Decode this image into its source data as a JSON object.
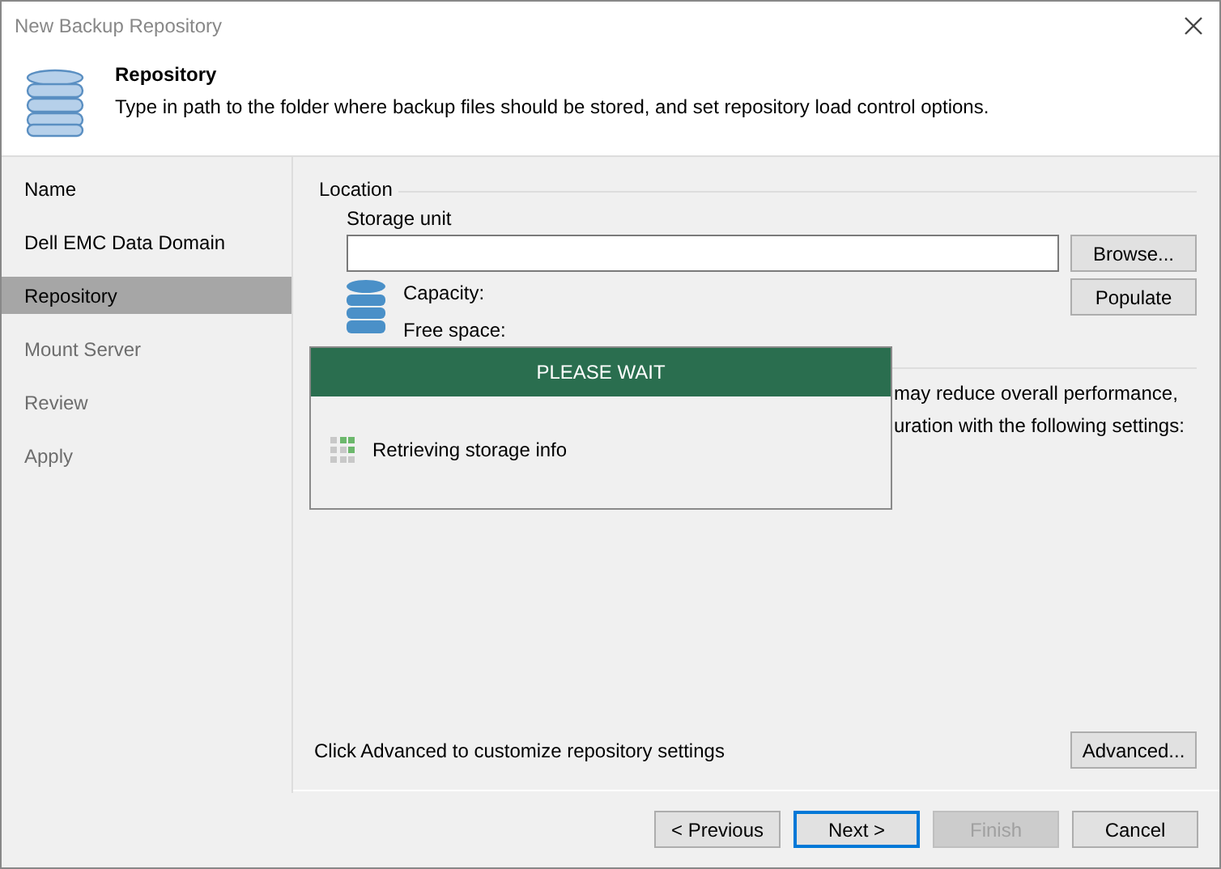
{
  "window": {
    "title": "New Backup Repository"
  },
  "header": {
    "title": "Repository",
    "description": "Type in path to the folder where backup files should be stored, and set repository load control options."
  },
  "steps": [
    {
      "label": "Name",
      "selected": false,
      "disabled": false
    },
    {
      "label": "Dell EMC Data Domain",
      "selected": false,
      "disabled": false
    },
    {
      "label": "Repository",
      "selected": true,
      "disabled": false
    },
    {
      "label": "Mount Server",
      "selected": false,
      "disabled": true
    },
    {
      "label": "Review",
      "selected": false,
      "disabled": true
    },
    {
      "label": "Apply",
      "selected": false,
      "disabled": true
    }
  ],
  "location": {
    "group_label": "Location",
    "field_label": "Storage unit",
    "browse_button": "Browse...",
    "populate_button": "Populate",
    "capacity_label": "Capacity:",
    "free_space_label": "Free space:"
  },
  "load_control": {
    "text_lines": [
      "may reduce overall performance,",
      "uration with the following settings:"
    ]
  },
  "progress_dialog": {
    "title": "PLEASE WAIT",
    "message": "Retrieving storage info"
  },
  "advanced": {
    "text": "Click Advanced to customize repository settings",
    "button": "Advanced..."
  },
  "buttons": [
    {
      "label": "< Previous",
      "disabled": false,
      "default": false
    },
    {
      "label": "Next >",
      "disabled": false,
      "default": true
    },
    {
      "label": "Finish",
      "disabled": true,
      "default": false
    },
    {
      "label": "Cancel",
      "disabled": false,
      "default": false
    }
  ]
}
